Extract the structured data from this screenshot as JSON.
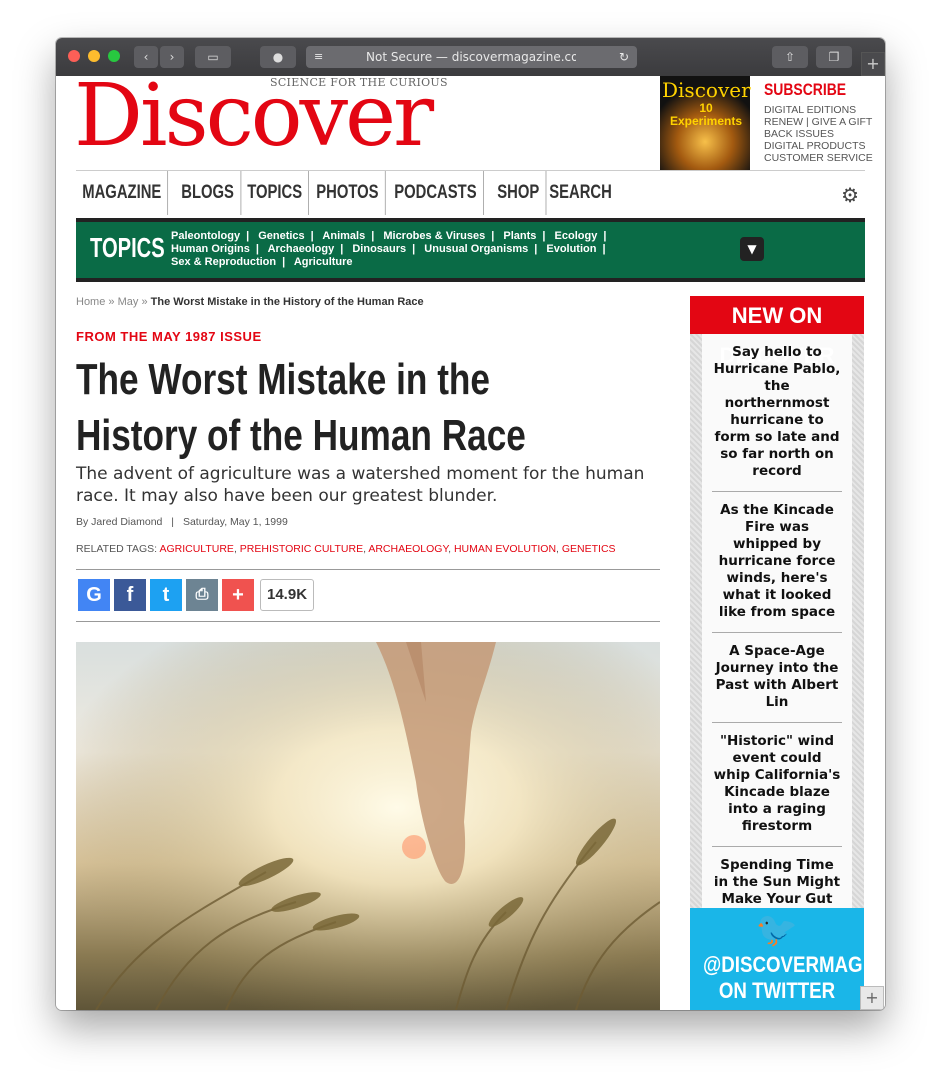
{
  "browser": {
    "url_text": "Not Secure — discovermagazine.com"
  },
  "masthead": {
    "logo_text": "Discover",
    "tagline": "SCIENCE FOR THE CURIOUS",
    "cover_title": "Discover",
    "cover_subtitle": "10 Experiments",
    "subscribe_title": "SUBSCRIBE",
    "subscribe_links": [
      "DIGITAL EDITIONS",
      "RENEW | GIVE A GIFT",
      "BACK ISSUES",
      "DIGITAL PRODUCTS",
      "CUSTOMER SERVICE"
    ]
  },
  "nav": {
    "items": [
      "MAGAZINE",
      "BLOGS",
      "TOPICS",
      "PHOTOS",
      "PODCASTS",
      "SHOP",
      "SEARCH"
    ]
  },
  "topics": {
    "title": "TOPICS",
    "links": [
      "Paleontology",
      "Genetics",
      "Animals",
      "Microbes & Viruses",
      "Plants",
      "Ecology",
      "Human Origins",
      "Archaeology",
      "Dinosaurs",
      "Unusual Organisms",
      "Evolution",
      "Sex & Reproduction",
      "Agriculture"
    ]
  },
  "breadcrumb": {
    "home": "Home",
    "sep": "»",
    "month": "May",
    "current": "The Worst Mistake in the History of the Human Race"
  },
  "article": {
    "issue": "FROM THE MAY 1987 ISSUE",
    "headline": "The Worst Mistake in the History of the Human Race",
    "dek": "The advent of agriculture was a watershed moment for the human race. It may also have been our greatest blunder.",
    "byline": "By Jared Diamond",
    "date": "Saturday, May 1, 1999",
    "tags_label": "RELATED TAGS:",
    "tags": [
      "AGRICULTURE",
      "PREHISTORIC CULTURE",
      "ARCHAEOLOGY",
      "HUMAN EVOLUTION",
      "GENETICS"
    ],
    "share_count": "14.9K"
  },
  "sidebar": {
    "title": "NEW ON DISCOVER",
    "items": [
      "Say hello to Hurricane Pablo, the northernmost hurricane to form so late and so far north on record",
      "As the Kincade Fire was whipped by hurricane force winds, here's what it looked like from space",
      "A Space-Age Journey into the Past with Albert Lin",
      "\"Historic\" wind event could whip California's Kincade blaze into a raging firestorm",
      "Spending Time in the Sun Might Make Your Gut Healthier"
    ],
    "twitter": "@DISCOVERMAG ON TWITTER"
  },
  "colors": {
    "brand_red": "#e30613",
    "topics_green": "#0a6b46",
    "twitter_blue": "#1ab6e8"
  },
  "icons": [
    "back-icon",
    "forward-icon",
    "sidebar-icon",
    "privacy-icon",
    "reader-icon",
    "reload-icon",
    "share-icon",
    "tabs-icon",
    "new-tab-icon",
    "gear-icon",
    "chevron-down-icon",
    "google-icon",
    "facebook-icon",
    "twitter-icon",
    "print-icon",
    "plus-icon",
    "twitter-bird-icon"
  ]
}
